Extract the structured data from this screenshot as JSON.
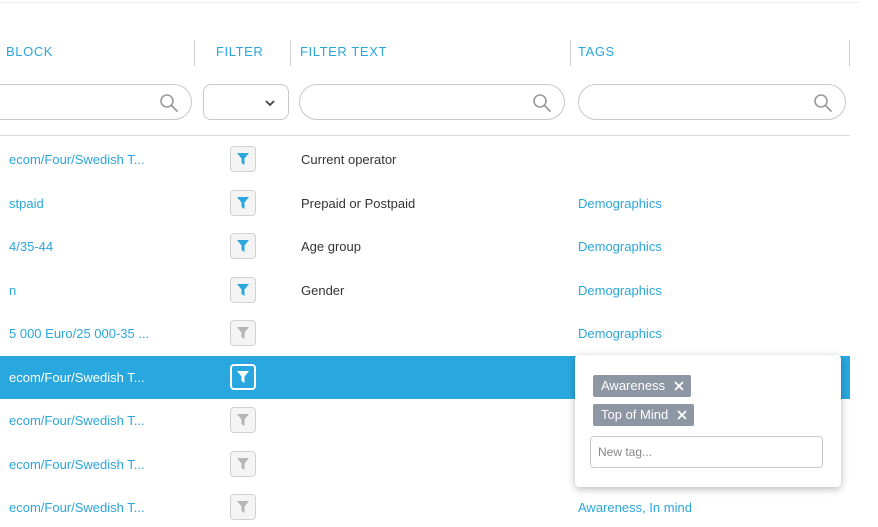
{
  "header": {
    "block": "BLOCK",
    "filter": "FILTER",
    "filter_text": "FILTER TEXT",
    "tags": "TAGS"
  },
  "filters": {
    "block_search": "",
    "filter_select_value": "",
    "filter_text_search": "",
    "tags_search": ""
  },
  "icons": {
    "search": "search-icon",
    "dropdown": "chevron-down-icon",
    "filter": "funnel-icon",
    "remove": "close-icon"
  },
  "colors": {
    "accent": "#2aa6dc",
    "selected_row": "#29a8df",
    "filter_active": "#2aa6dc",
    "filter_inactive": "#b5b5b5",
    "chip": "#8d96a3"
  },
  "rows": [
    {
      "block": "ecom/Four/Swedish T...",
      "filter_active": true,
      "filter_text": "Current operator",
      "tags": ""
    },
    {
      "block": "stpaid",
      "filter_active": true,
      "filter_text": "Prepaid or Postpaid",
      "tags": "Demographics"
    },
    {
      "block": "4/35-44",
      "filter_active": true,
      "filter_text": "Age group",
      "tags": "Demographics"
    },
    {
      "block": "n",
      "filter_active": true,
      "filter_text": "Gender",
      "tags": "Demographics"
    },
    {
      "block": "5 000 Euro/25 000-35 ...",
      "filter_active": false,
      "filter_text": "",
      "tags": "Demographics"
    },
    {
      "block": "ecom/Four/Swedish T...",
      "filter_active": false,
      "filter_text": "",
      "tags": "",
      "selected": true
    },
    {
      "block": "ecom/Four/Swedish T...",
      "filter_active": false,
      "filter_text": "",
      "tags": ""
    },
    {
      "block": "ecom/Four/Swedish T...",
      "filter_active": false,
      "filter_text": "",
      "tags": ""
    },
    {
      "block": "ecom/Four/Swedish T...",
      "filter_active": false,
      "filter_text": "",
      "tags": "Awareness, In mind"
    }
  ],
  "tag_popup": {
    "chips": [
      "Awareness",
      "Top of Mind"
    ],
    "new_tag_placeholder": "New tag...",
    "new_tag_value": ""
  }
}
